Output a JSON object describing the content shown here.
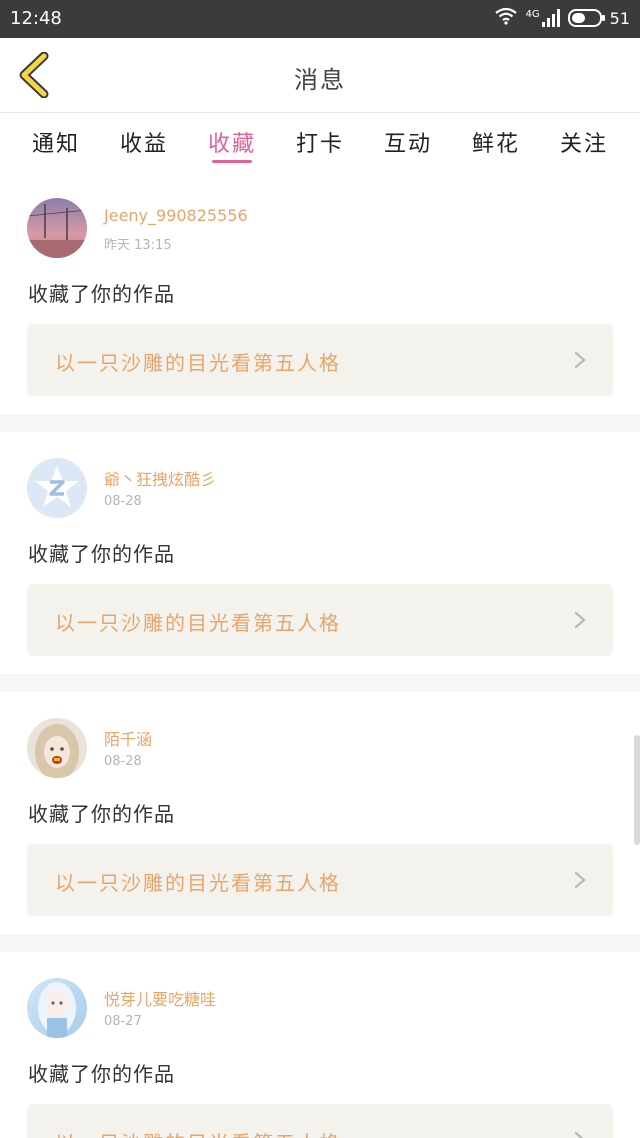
{
  "status_bar": {
    "time": "12:48",
    "network_label": "4G",
    "battery_level": "51",
    "icons": [
      "wifi-icon",
      "signal-icon",
      "battery-icon"
    ]
  },
  "header": {
    "title": "消息",
    "back_icon": "chevron-left-icon"
  },
  "tabs": [
    {
      "label": "通知",
      "active": false
    },
    {
      "label": "收益",
      "active": false
    },
    {
      "label": "收藏",
      "active": true
    },
    {
      "label": "打卡",
      "active": false
    },
    {
      "label": "互动",
      "active": false
    },
    {
      "label": "鲜花",
      "active": false
    },
    {
      "label": "关注",
      "active": false
    }
  ],
  "notifications": [
    {
      "username": "Jeeny_990825556",
      "time": "昨天 13:15",
      "action": "收藏了你的作品",
      "work_title": "以一只沙雕的目光看第五人格"
    },
    {
      "username": "爺丶狂拽炫酷彡",
      "time": "08-28",
      "action": "收藏了你的作品",
      "work_title": "以一只沙雕的目光看第五人格"
    },
    {
      "username": "陌千涵",
      "time": "08-28",
      "action": "收藏了你的作品",
      "work_title": "以一只沙雕的目光看第五人格"
    },
    {
      "username": "悦芽儿要吃糖哇",
      "time": "08-27",
      "action": "收藏了你的作品",
      "work_title": "以一只沙雕的目光看第五人格"
    }
  ],
  "colors": {
    "accent_pink": "#e0609a",
    "username_orange": "#e8a56a",
    "card_bg": "#f4f2ec",
    "status_bar": "#3b3b3b",
    "back_icon_yellow": "#f3d645"
  }
}
